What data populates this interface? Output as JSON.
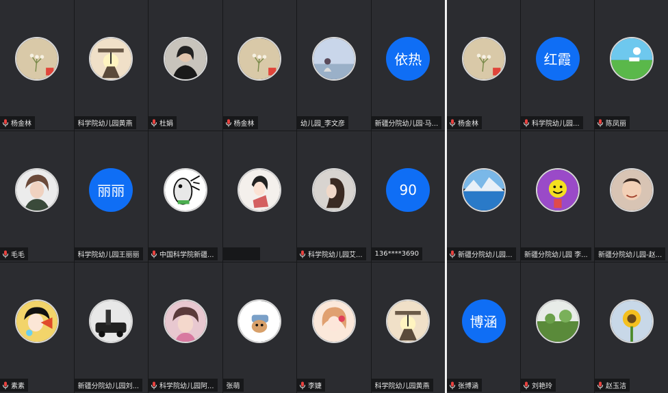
{
  "colors": {
    "accent": "#0f6ef5",
    "tile_bg": "#2b2c30",
    "mic_red": "#e8423f"
  },
  "left_panel": {
    "tiles": [
      {
        "name": "杨金林",
        "mic": true,
        "avatar": "flower-icon"
      },
      {
        "name": "科学院幼儿园黄燕",
        "mic": false,
        "avatar": "balance-rock-icon"
      },
      {
        "name": "杜娟",
        "mic": true,
        "avatar": "woman-photo-icon"
      },
      {
        "name": "杨金林",
        "mic": true,
        "avatar": "flower-icon"
      },
      {
        "name": "幼儿园_李文彦",
        "mic": false,
        "avatar": "seaside-girl-icon"
      },
      {
        "name": "新疆分院幼儿园·马...",
        "mic": false,
        "avatar_text": "依热"
      },
      {
        "name": "毛毛",
        "mic": true,
        "avatar": "portrait-icon"
      },
      {
        "name": "科学院幼儿园王丽丽",
        "mic": false,
        "avatar_text": "丽丽"
      },
      {
        "name": "中国科学院新疆...",
        "mic": true,
        "avatar": "cartoon-fish-icon"
      },
      {
        "name": "",
        "mic": false,
        "avatar": "anime-girl-icon"
      },
      {
        "name": "科学院幼儿园艾...",
        "mic": true,
        "avatar": "woman-profile-icon"
      },
      {
        "name": "136****3690",
        "mic": false,
        "avatar_text": "90"
      },
      {
        "name": "素素",
        "mic": true,
        "avatar": "cartoon-girl-icon"
      },
      {
        "name": "新疆分院幼儿园刘...",
        "mic": false,
        "avatar": "car-photo-icon"
      },
      {
        "name": "科学院幼儿园阿...",
        "mic": true,
        "avatar": "woman-portrait-icon"
      },
      {
        "name": "张萌",
        "mic": false,
        "avatar": "puppy-icon"
      },
      {
        "name": "李婕",
        "mic": true,
        "avatar": "anime-redhair-icon"
      },
      {
        "name": "科学院幼儿园黄燕",
        "mic": false,
        "avatar": "balance-rock-icon"
      }
    ]
  },
  "right_panel": {
    "tiles": [
      {
        "name": "杨金林",
        "mic": true,
        "avatar": "flower-icon"
      },
      {
        "name": "科学院幼儿园...",
        "mic": true,
        "avatar_text": "红霞"
      },
      {
        "name": "陈凤丽",
        "mic": true,
        "avatar": "landscape-icon"
      },
      {
        "name": "新疆分院幼儿园...",
        "mic": true,
        "avatar": "mountain-lake-icon"
      },
      {
        "name": "新疆分院幼儿园 李...",
        "mic": false,
        "avatar": "smiley-icon"
      },
      {
        "name": "新疆分院幼儿园-赵...",
        "mic": false,
        "avatar": "baby-photo-icon"
      },
      {
        "name": "张博涵",
        "mic": true,
        "avatar_text": "博涵"
      },
      {
        "name": "刘艳玲",
        "mic": true,
        "avatar": "garden-icon"
      },
      {
        "name": "赵玉洁",
        "mic": true,
        "avatar": "sunflower-icon"
      }
    ]
  }
}
